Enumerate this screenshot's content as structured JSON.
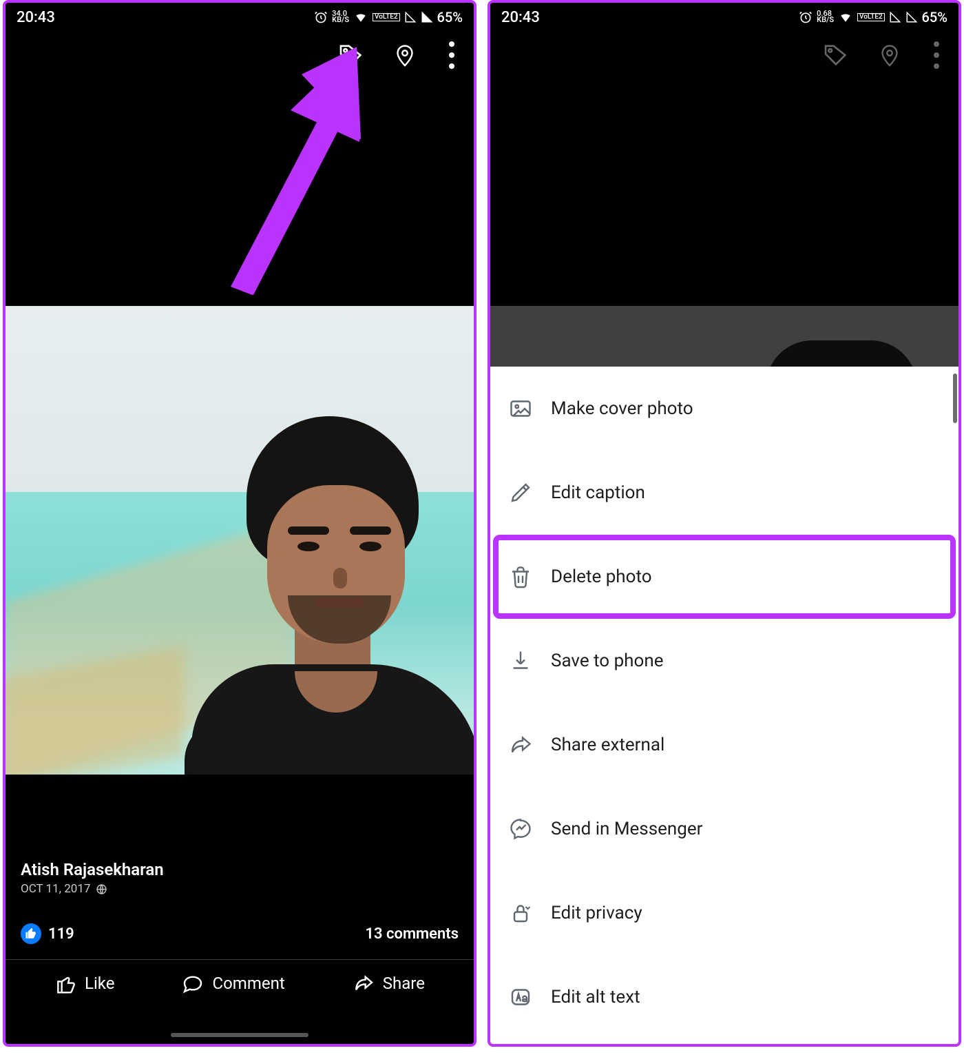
{
  "left": {
    "status": {
      "time": "20:43",
      "speed_top": "34.0",
      "speed_unit": "KB/S",
      "lte": "VoLTE2",
      "battery": "65%"
    },
    "post": {
      "user": "Atish Rajasekharan",
      "date": "OCT 11, 2017",
      "likes": "119",
      "comments": "13 comments",
      "actions": {
        "like": "Like",
        "comment": "Comment",
        "share": "Share"
      }
    }
  },
  "right": {
    "status": {
      "time": "20:43",
      "speed_top": "0.68",
      "speed_unit": "KB/S",
      "lte": "VoLTE2",
      "battery": "65%"
    },
    "menu": {
      "make_cover": "Make cover photo",
      "edit_caption": "Edit caption",
      "delete": "Delete photo",
      "save": "Save to phone",
      "share_ext": "Share external",
      "messenger": "Send in Messenger",
      "privacy": "Edit privacy",
      "alt": "Edit alt text"
    }
  }
}
